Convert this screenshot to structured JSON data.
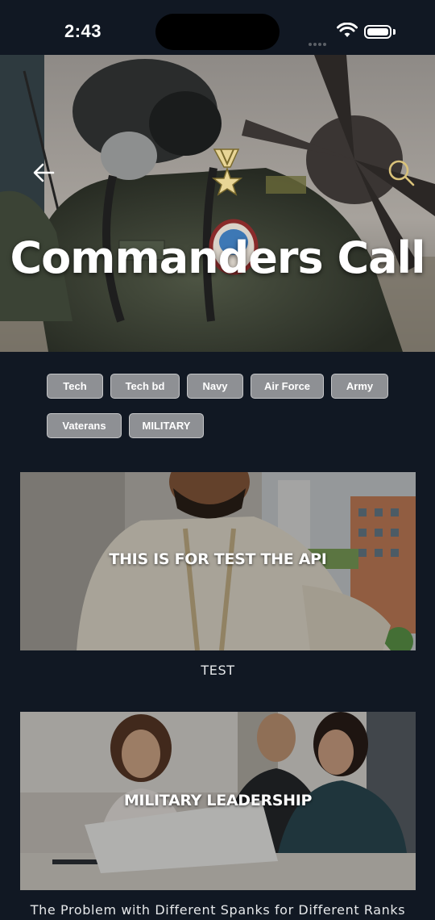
{
  "status_bar": {
    "time": "2:43"
  },
  "hero": {
    "title": "Commanders Call"
  },
  "categories": [
    "Tech",
    "Tech bd",
    "Navy",
    "Air Force",
    "Army",
    "Vaterans",
    "MILITARY"
  ],
  "posts": [
    {
      "image_title": "THIS IS FOR TEST THE API",
      "caption": "TEST"
    },
    {
      "image_title": "MILITARY LEADERSHIP",
      "caption": "The Problem with Different Spanks for Different Ranks"
    }
  ],
  "colors": {
    "background": "#111823",
    "chip_bg": "#8e9094",
    "search_accent": "#d9c27a"
  },
  "icons": [
    "back-arrow-icon",
    "search-icon",
    "medal-icon",
    "wifi-icon",
    "battery-icon"
  ]
}
